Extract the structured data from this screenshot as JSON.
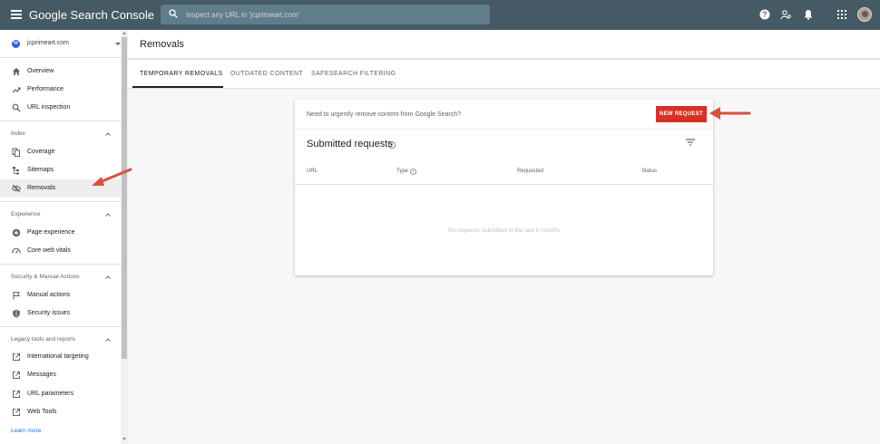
{
  "app": {
    "product_name": "Google Search Console",
    "search_placeholder": "Inspect any URL in 'jcprimeart.com'"
  },
  "sidebar": {
    "property": "jcprimeart.com",
    "top_items": [
      {
        "label": "Overview",
        "icon": "home-icon"
      },
      {
        "label": "Performance",
        "icon": "trending-up-icon"
      },
      {
        "label": "URL inspection",
        "icon": "search-icon"
      }
    ],
    "sections": [
      {
        "title": "Index",
        "items": [
          {
            "label": "Coverage",
            "icon": "file-copy-icon"
          },
          {
            "label": "Sitemaps",
            "icon": "sitemap-icon"
          },
          {
            "label": "Removals",
            "icon": "eye-off-icon",
            "active": true
          }
        ]
      },
      {
        "title": "Experience",
        "items": [
          {
            "label": "Page experience",
            "icon": "add-circle-icon"
          },
          {
            "label": "Core web vitals",
            "icon": "speed-gauge-icon"
          }
        ]
      },
      {
        "title": "Security & Manual Actions",
        "items": [
          {
            "label": "Manual actions",
            "icon": "flag-icon"
          },
          {
            "label": "Security issues",
            "icon": "shield-icon"
          }
        ]
      },
      {
        "title": "Legacy tools and reports",
        "items": [
          {
            "label": "International targeting",
            "icon": "external-link-icon"
          },
          {
            "label": "Messages",
            "icon": "external-link-icon"
          },
          {
            "label": "URL parameters",
            "icon": "external-link-icon"
          },
          {
            "label": "Web Tools",
            "icon": "external-link-icon"
          }
        ]
      }
    ],
    "learn_more": "Learn more"
  },
  "main": {
    "page_title": "Removals",
    "tabs": [
      {
        "label": "TEMPORARY REMOVALS",
        "active": true
      },
      {
        "label": "OUTDATED CONTENT",
        "active": false
      },
      {
        "label": "SAFESEARCH FILTERING",
        "active": false
      }
    ],
    "card": {
      "prompt": "Need to urgently remove content from Google Search?",
      "new_request": "NEW REQUEST",
      "title": "Submitted requests",
      "columns": [
        "URL",
        "Type",
        "Requested",
        "Status"
      ],
      "empty_message": "No requests submitted in the last 6 months"
    }
  },
  "colors": {
    "topbar": "#455a64",
    "accent_red": "#d93025",
    "annotation_arrow": "#d9503f"
  }
}
